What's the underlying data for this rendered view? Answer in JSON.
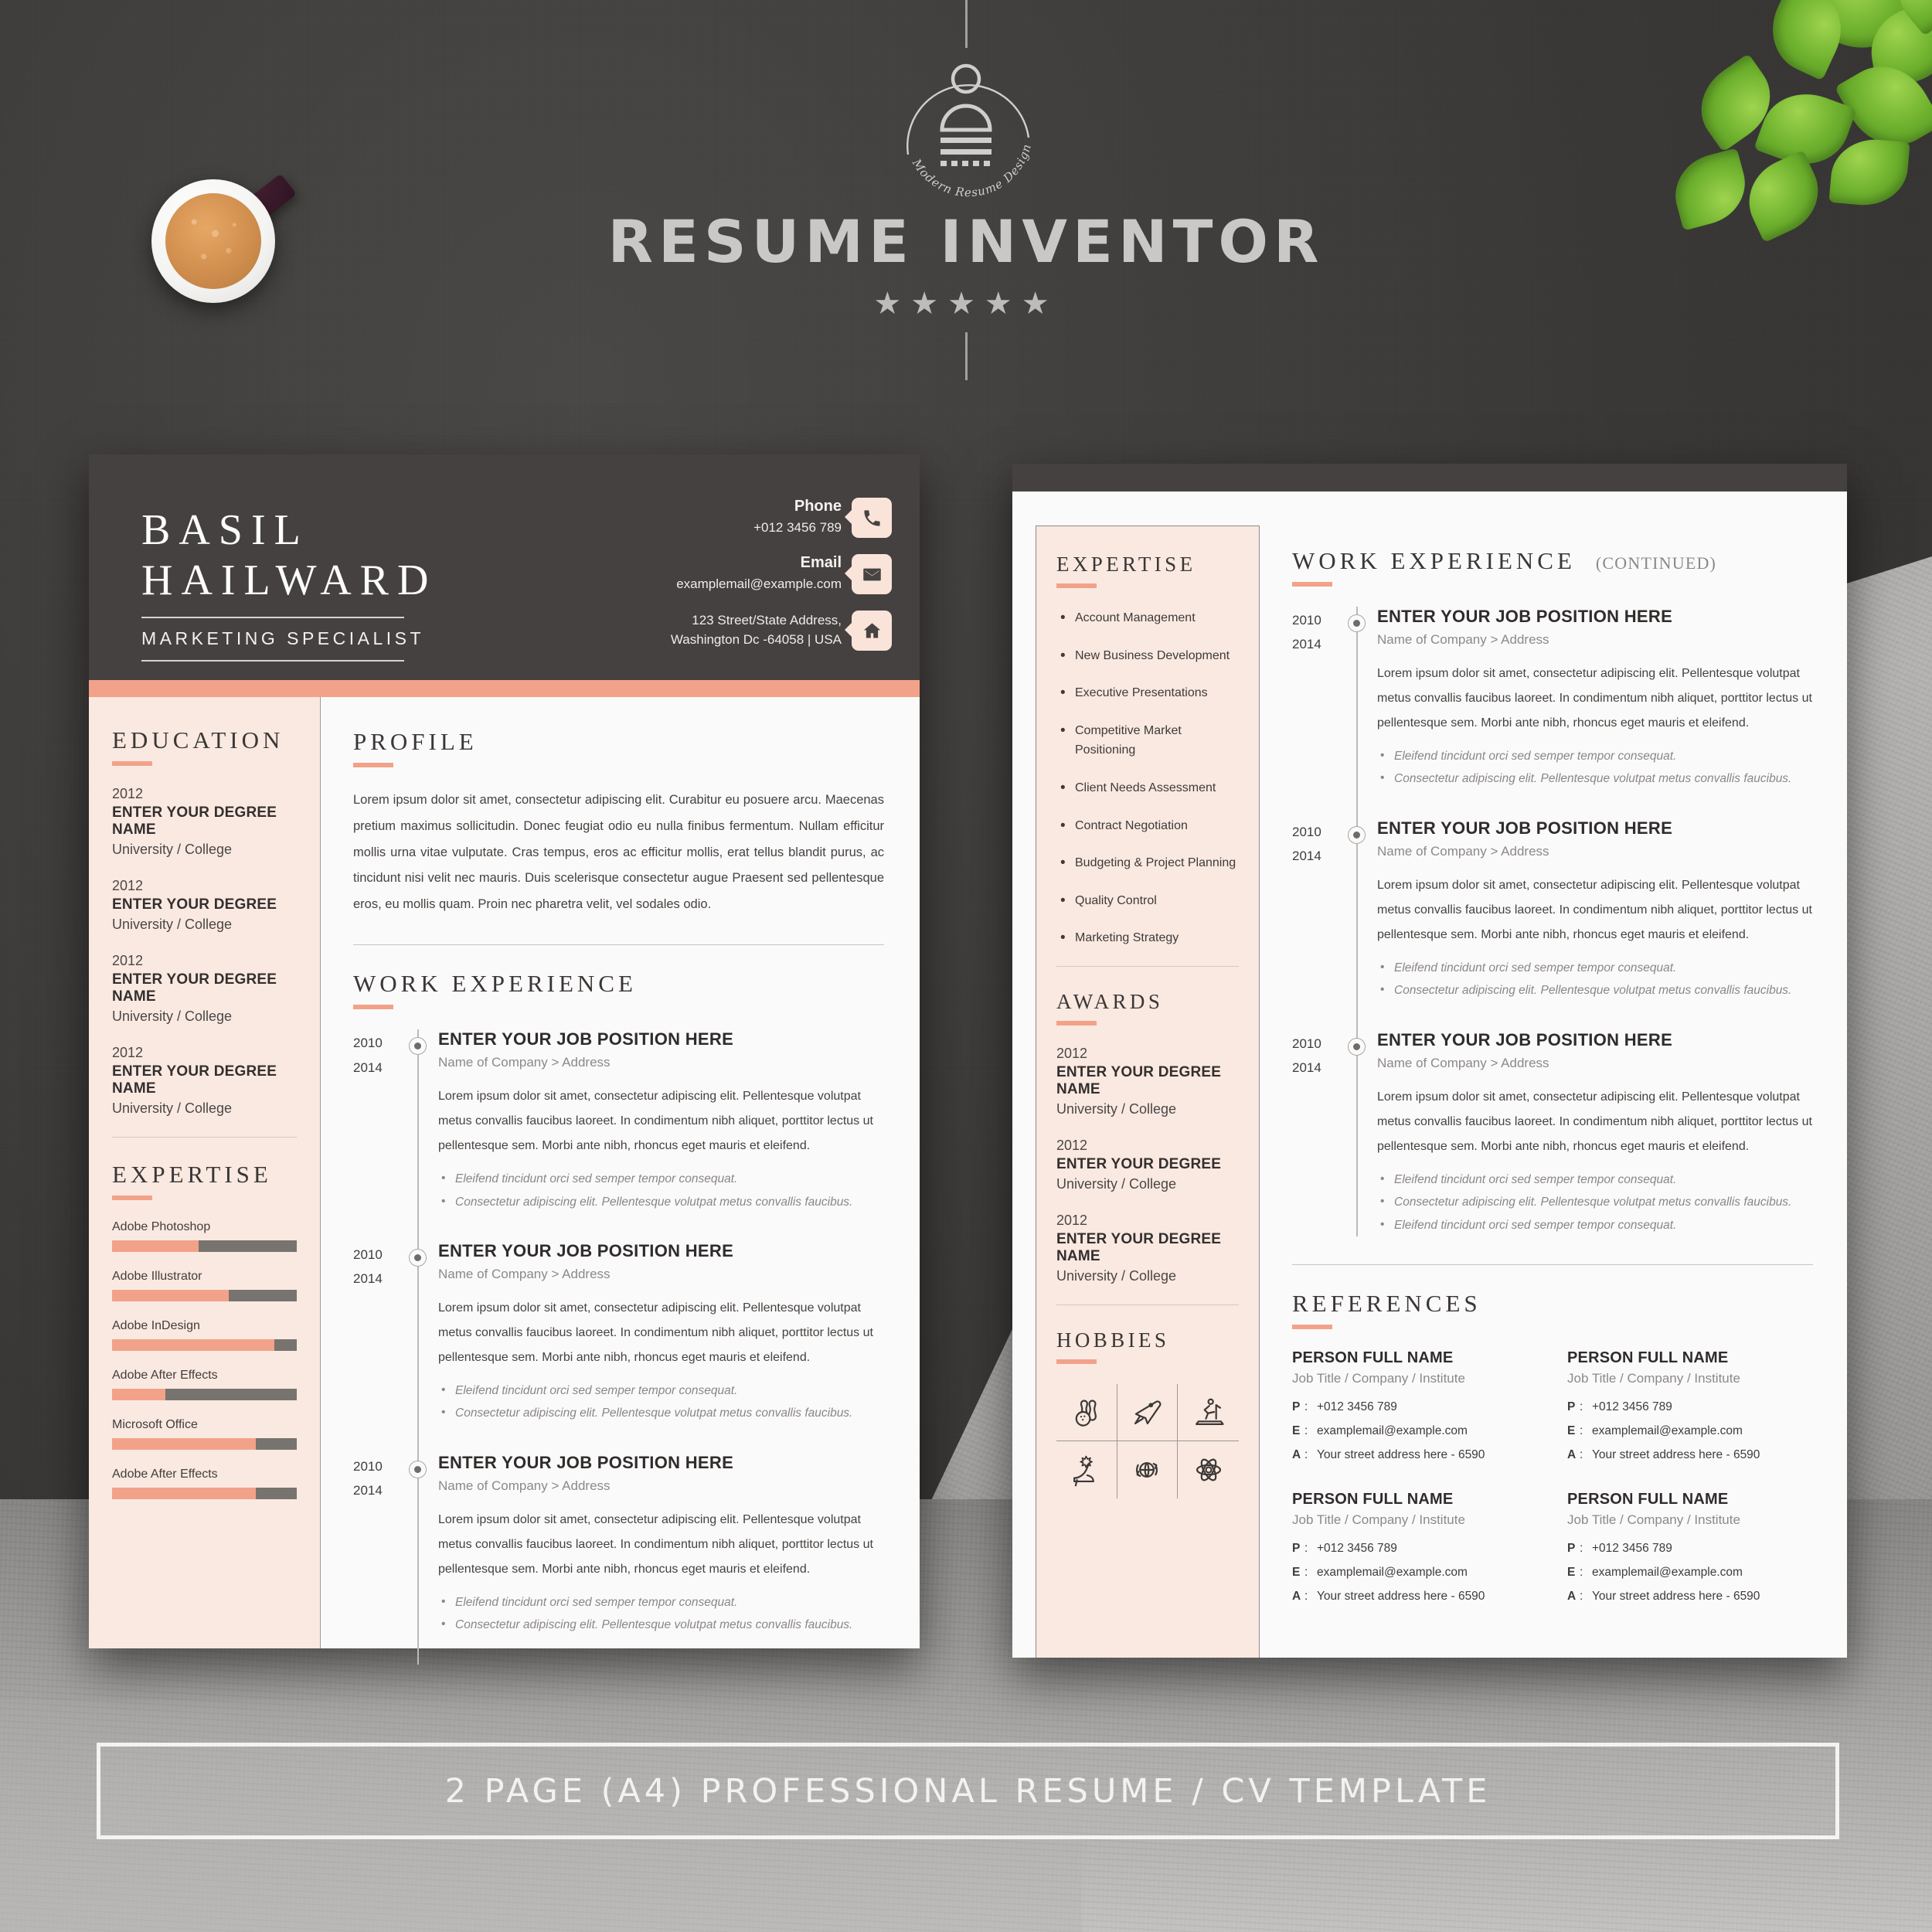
{
  "brand": {
    "title": "RESUME INVENTOR",
    "logo_tagline": "Modern Resume Design",
    "stars": "★★★★★"
  },
  "footer": {
    "text": "2 PAGE (A4) PROFESSIONAL RESUME / CV TEMPLATE"
  },
  "colors": {
    "accent": "#F2A289",
    "dark": "#454140",
    "sidebar_pink": "#FAE9E1",
    "page": "#FBFAFA",
    "skill_track": "#77736F"
  },
  "page1": {
    "header": {
      "first_name": "BASIL",
      "last_name": "HAILWARD",
      "role": "MARKETING SPECIALIST",
      "contacts": [
        {
          "label": "Phone",
          "value": "+012 3456 789",
          "icon": "phone-icon"
        },
        {
          "label": "Email",
          "value": "examplemail@example.com",
          "icon": "envelope-icon"
        },
        {
          "label": "",
          "value": "123 Street/State Address,\nWashington Dc -64058 | USA",
          "value_line1": "123 Street/State Address,",
          "value_line2": "Washington Dc -64058 | USA",
          "icon": "home-icon"
        }
      ]
    },
    "education": {
      "heading": "EDUCATION",
      "entries": [
        {
          "year": "2012",
          "title": "ENTER YOUR DEGREE NAME",
          "sub": "University / College"
        },
        {
          "year": "2012",
          "title": "ENTER YOUR DEGREE",
          "sub": "University / College"
        },
        {
          "year": "2012",
          "title": "ENTER YOUR DEGREE NAME",
          "sub": "University / College"
        },
        {
          "year": "2012",
          "title": "ENTER YOUR DEGREE NAME",
          "sub": "University / College"
        }
      ]
    },
    "expertise": {
      "heading": "EXPERTISE",
      "skills": [
        {
          "name": "Adobe Photoshop",
          "value": 47
        },
        {
          "name": "Adobe Illustrator",
          "value": 63
        },
        {
          "name": "Adobe InDesign",
          "value": 88
        },
        {
          "name": "Adobe After Effects",
          "value": 29
        },
        {
          "name": "Microsoft Office",
          "value": 78
        },
        {
          "name": "Adobe After Effects",
          "value": 78
        }
      ]
    },
    "profile": {
      "heading": "PROFILE",
      "text": "Lorem ipsum dolor sit amet, consectetur adipiscing elit. Curabitur eu posuere arcu. Maecenas pretium maximus sollicitudin. Donec feugiat odio eu nulla finibus fermentum. Nullam efficitur mollis urna vitae vulputate. Cras tempus, eros ac efficitur mollis, erat tellus blandit purus, ac tincidunt nisi velit nec mauris. Duis scelerisque consectetur augue Praesent sed pellentesque eros, eu mollis quam. Proin nec pharetra velit, vel sodales odio."
    },
    "work": {
      "heading": "WORK EXPERIENCE",
      "jobs": [
        {
          "year_start": "2010",
          "year_end": "2014",
          "title": "ENTER YOUR JOB POSITION HERE",
          "company": "Name of Company > Address",
          "desc": "Lorem ipsum dolor sit amet, consectetur adipiscing elit. Pellentesque volutpat metus convallis faucibus laoreet. In condimentum nibh aliquet, porttitor lectus ut  pellentesque sem. Morbi ante nibh, rhoncus eget mauris et eleifend.",
          "bullets": [
            "Eleifend tincidunt orci sed semper tempor consequat.",
            "Consectetur adipiscing elit. Pellentesque volutpat metus convallis faucibus."
          ]
        },
        {
          "year_start": "2010",
          "year_end": "2014",
          "title": "ENTER YOUR JOB POSITION HERE",
          "company": "Name of Company > Address",
          "desc": "Lorem ipsum dolor sit amet, consectetur adipiscing elit. Pellentesque volutpat metus convallis faucibus laoreet. In condimentum nibh aliquet, porttitor lectus ut  pellentesque sem. Morbi ante nibh, rhoncus eget mauris et eleifend.",
          "bullets": [
            "Eleifend tincidunt orci sed semper tempor consequat.",
            "Consectetur adipiscing elit. Pellentesque volutpat metus convallis faucibus."
          ]
        },
        {
          "year_start": "2010",
          "year_end": "2014",
          "title": "ENTER YOUR JOB POSITION HERE",
          "company": "Name of Company > Address",
          "desc": "Lorem ipsum dolor sit amet, consectetur adipiscing elit. Pellentesque volutpat metus convallis faucibus laoreet. In condimentum nibh aliquet, porttitor lectus ut  pellentesque sem. Morbi ante nibh, rhoncus eget mauris et eleifend.",
          "bullets": [
            "Eleifend tincidunt orci sed semper tempor consequat.",
            "Consectetur adipiscing elit. Pellentesque volutpat metus convallis faucibus."
          ]
        }
      ]
    }
  },
  "page2": {
    "expertise": {
      "heading": "EXPERTISE",
      "items": [
        "Account Management",
        "New Business Development",
        "Executive Presentations",
        "Competitive Market Positioning",
        "Client Needs Assessment",
        "Contract Negotiation",
        "Budgeting & Project Planning",
        "Quality Control",
        "Marketing Strategy"
      ]
    },
    "awards": {
      "heading": "AWARDS",
      "entries": [
        {
          "year": "2012",
          "title": "ENTER YOUR DEGREE NAME",
          "sub": "University / College"
        },
        {
          "year": "2012",
          "title": "ENTER YOUR DEGREE",
          "sub": "University / College"
        },
        {
          "year": "2012",
          "title": "ENTER YOUR DEGREE NAME",
          "sub": "University / College"
        }
      ]
    },
    "hobbies": {
      "heading": "HOBBIES",
      "icons": [
        "bowling-icon",
        "airplane-icon",
        "treadmill-icon",
        "high-heel-shoe-icon",
        "globe-recycle-icon",
        "atom-icon"
      ]
    },
    "work": {
      "heading": "WORK EXPERIENCE",
      "continued": "(CONTINUED)",
      "jobs": [
        {
          "year_start": "2010",
          "year_end": "2014",
          "title": "ENTER YOUR JOB POSITION HERE",
          "company": "Name of Company > Address",
          "desc": "Lorem ipsum dolor sit amet, consectetur adipiscing elit. Pellentesque volutpat metus convallis faucibus laoreet. In condimentum nibh aliquet, porttitor lectus ut  pellentesque sem. Morbi ante nibh, rhoncus eget mauris et eleifend.",
          "bullets": [
            "Eleifend tincidunt orci sed semper tempor consequat.",
            "Consectetur adipiscing elit. Pellentesque volutpat metus convallis faucibus."
          ]
        },
        {
          "year_start": "2010",
          "year_end": "2014",
          "title": "ENTER YOUR JOB POSITION HERE",
          "company": "Name of Company > Address",
          "desc": "Lorem ipsum dolor sit amet, consectetur adipiscing elit. Pellentesque volutpat metus convallis faucibus laoreet. In condimentum nibh aliquet, porttitor lectus ut  pellentesque sem. Morbi ante nibh, rhoncus eget mauris et eleifend.",
          "bullets": [
            "Eleifend tincidunt orci sed semper tempor consequat.",
            "Consectetur adipiscing elit. Pellentesque volutpat metus convallis faucibus."
          ]
        },
        {
          "year_start": "2010",
          "year_end": "2014",
          "title": "ENTER YOUR JOB POSITION HERE",
          "company": "Name of Company > Address",
          "desc": "Lorem ipsum dolor sit amet, consectetur adipiscing elit. Pellentesque volutpat metus convallis faucibus laoreet. In condimentum nibh aliquet, porttitor lectus ut  pellentesque sem. Morbi ante nibh, rhoncus eget mauris et eleifend.",
          "bullets": [
            "Eleifend tincidunt orci sed semper tempor consequat.",
            "Consectetur adipiscing elit. Pellentesque volutpat metus convallis faucibus.",
            "Eleifend tincidunt orci sed semper tempor consequat."
          ]
        }
      ]
    },
    "references": {
      "heading": "REFERENCES",
      "items": [
        {
          "name": "PERSON FULL NAME",
          "role": "Job Title / Company / Institute",
          "phone_key": "P",
          "phone": "+012 3456 789",
          "email_key": "E",
          "email": "examplemail@example.com",
          "addr_key": "A",
          "addr": "Your street address here - 6590"
        },
        {
          "name": "PERSON FULL NAME",
          "role": "Job Title / Company / Institute",
          "phone_key": "P",
          "phone": "+012 3456 789",
          "email_key": "E",
          "email": "examplemail@example.com",
          "addr_key": "A",
          "addr": "Your street address here - 6590"
        },
        {
          "name": "PERSON FULL NAME",
          "role": "Job Title / Company / Institute",
          "phone_key": "P",
          "phone": "+012 3456 789",
          "email_key": "E",
          "email": "examplemail@example.com",
          "addr_key": "A",
          "addr": "Your street address here - 6590"
        },
        {
          "name": "PERSON FULL NAME",
          "role": "Job Title / Company / Institute",
          "phone_key": "P",
          "phone": "+012 3456 789",
          "email_key": "E",
          "email": "examplemail@example.com",
          "addr_key": "A",
          "addr": "Your street address here - 6590"
        }
      ]
    }
  }
}
